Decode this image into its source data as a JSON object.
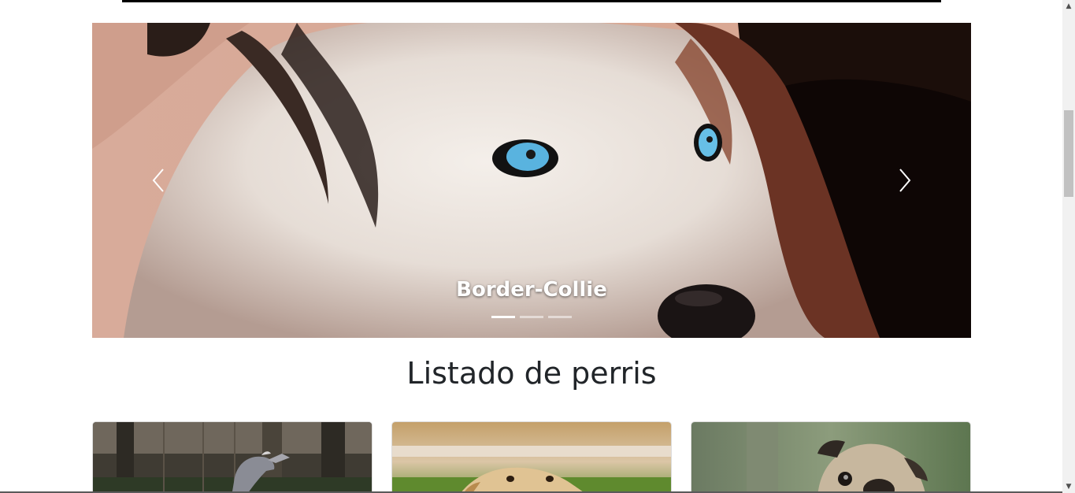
{
  "carousel": {
    "caption": "Border-Collie",
    "indicators": [
      true,
      false,
      false
    ],
    "prev_icon": "chevron-left-icon",
    "next_icon": "chevron-right-icon"
  },
  "section": {
    "title": "Listado de perris"
  },
  "cards": [
    {
      "image": "greyhound-photo"
    },
    {
      "image": "golden-retriever-photo"
    },
    {
      "image": "pug-photo"
    }
  ],
  "scrollbar": {
    "up_icon": "▲",
    "down_icon": "▼"
  }
}
